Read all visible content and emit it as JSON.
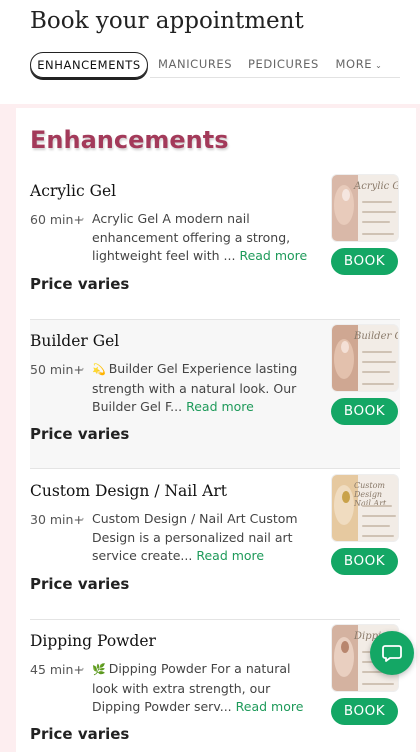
{
  "header": {
    "title": "Book your appointment"
  },
  "tabs": [
    {
      "label": "ENHANCEMENTS",
      "active": true
    },
    {
      "label": "MANICURES",
      "active": false
    },
    {
      "label": "PEDICURES",
      "active": false
    },
    {
      "label": "MORE",
      "active": false,
      "icon": "chevron-down-icon"
    }
  ],
  "section": {
    "title": "Enhancements"
  },
  "services": [
    {
      "name": "Acrylic Gel",
      "duration": "60 min+",
      "description": "Acrylic Gel A modern nail enhancement offering a strong, lightweight feel with ...",
      "emoji": "",
      "read_more": "Read more",
      "price": "Price varies",
      "book_label": "BOOK",
      "thumb_text": "Acrylic Gel"
    },
    {
      "name": "Builder Gel",
      "duration": "50 min+",
      "description": "Builder Gel Experience lasting strength with a natural look. Our Builder Gel F...",
      "emoji": "💫",
      "read_more": "Read more",
      "price": "Price varies",
      "book_label": "BOOK",
      "thumb_text": "Builder Gel"
    },
    {
      "name": "Custom Design / Nail Art",
      "duration": "30 min+",
      "description": "Custom Design / Nail Art Custom Design is a personalized nail art service create...",
      "emoji": "",
      "read_more": "Read more",
      "price": "Price varies",
      "book_label": "BOOK",
      "thumb_text": "Custom Design Nail Art"
    },
    {
      "name": "Dipping Powder",
      "duration": "45 min+",
      "description": "Dipping Powder For a natural look with extra strength, our Dipping Powder serv...",
      "emoji": "🌿",
      "read_more": "Read more",
      "price": "Price varies",
      "book_label": "BOOK",
      "thumb_text": "Dipping Powder"
    }
  ],
  "colors": {
    "accent_green": "#14a765",
    "section_title": "#a33a5a",
    "page_bg": "#fdeef0"
  },
  "chat": {
    "icon": "chat-bubble-icon"
  }
}
